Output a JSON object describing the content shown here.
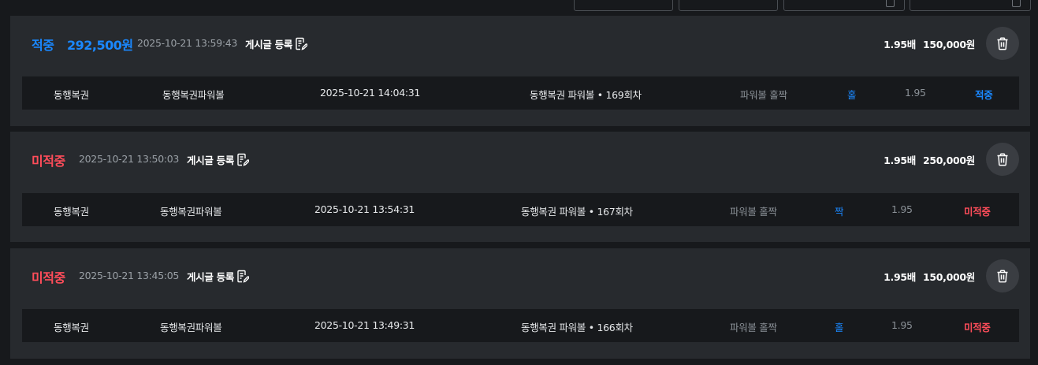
{
  "bets": [
    {
      "status": "적중",
      "payout": "292,500원",
      "created_at": "2025-10-21 13:59:43",
      "post_label": "게시글 등록",
      "odds": "1.95배",
      "amount": "150,000원",
      "detail": {
        "game": "동행복권",
        "category": "동행복권파워볼",
        "draw_time": "2025-10-21 14:04:31",
        "round": "동행복권 파워볼 • 169회차",
        "bet_type": "파워볼 홀짝",
        "pick": "홀",
        "rate": "1.95",
        "result": "적중"
      }
    },
    {
      "status": "미적중",
      "created_at": "2025-10-21 13:50:03",
      "post_label": "게시글 등록",
      "odds": "1.95배",
      "amount": "250,000원",
      "detail": {
        "game": "동행복권",
        "category": "동행복권파워볼",
        "draw_time": "2025-10-21 13:54:31",
        "round": "동행복권 파워볼 • 167회차",
        "bet_type": "파워볼 홀짝",
        "pick": "짝",
        "rate": "1.95",
        "result": "미적중"
      }
    },
    {
      "status": "미적중",
      "created_at": "2025-10-21 13:45:05",
      "post_label": "게시글 등록",
      "odds": "1.95배",
      "amount": "150,000원",
      "detail": {
        "game": "동행복권",
        "category": "동행복권파워볼",
        "draw_time": "2025-10-21 13:49:31",
        "round": "동행복권 파워볼 • 166회차",
        "bet_type": "파워볼 홀짝",
        "pick": "홀",
        "rate": "1.95",
        "result": "미적중"
      }
    }
  ],
  "colors": {
    "hit": "#1a88ff",
    "miss": "#ff4d5a",
    "card_bg": "#272a2e",
    "row_bg": "#17191c"
  },
  "icons": {
    "post": "edit-document-icon",
    "delete": "trash-icon"
  }
}
